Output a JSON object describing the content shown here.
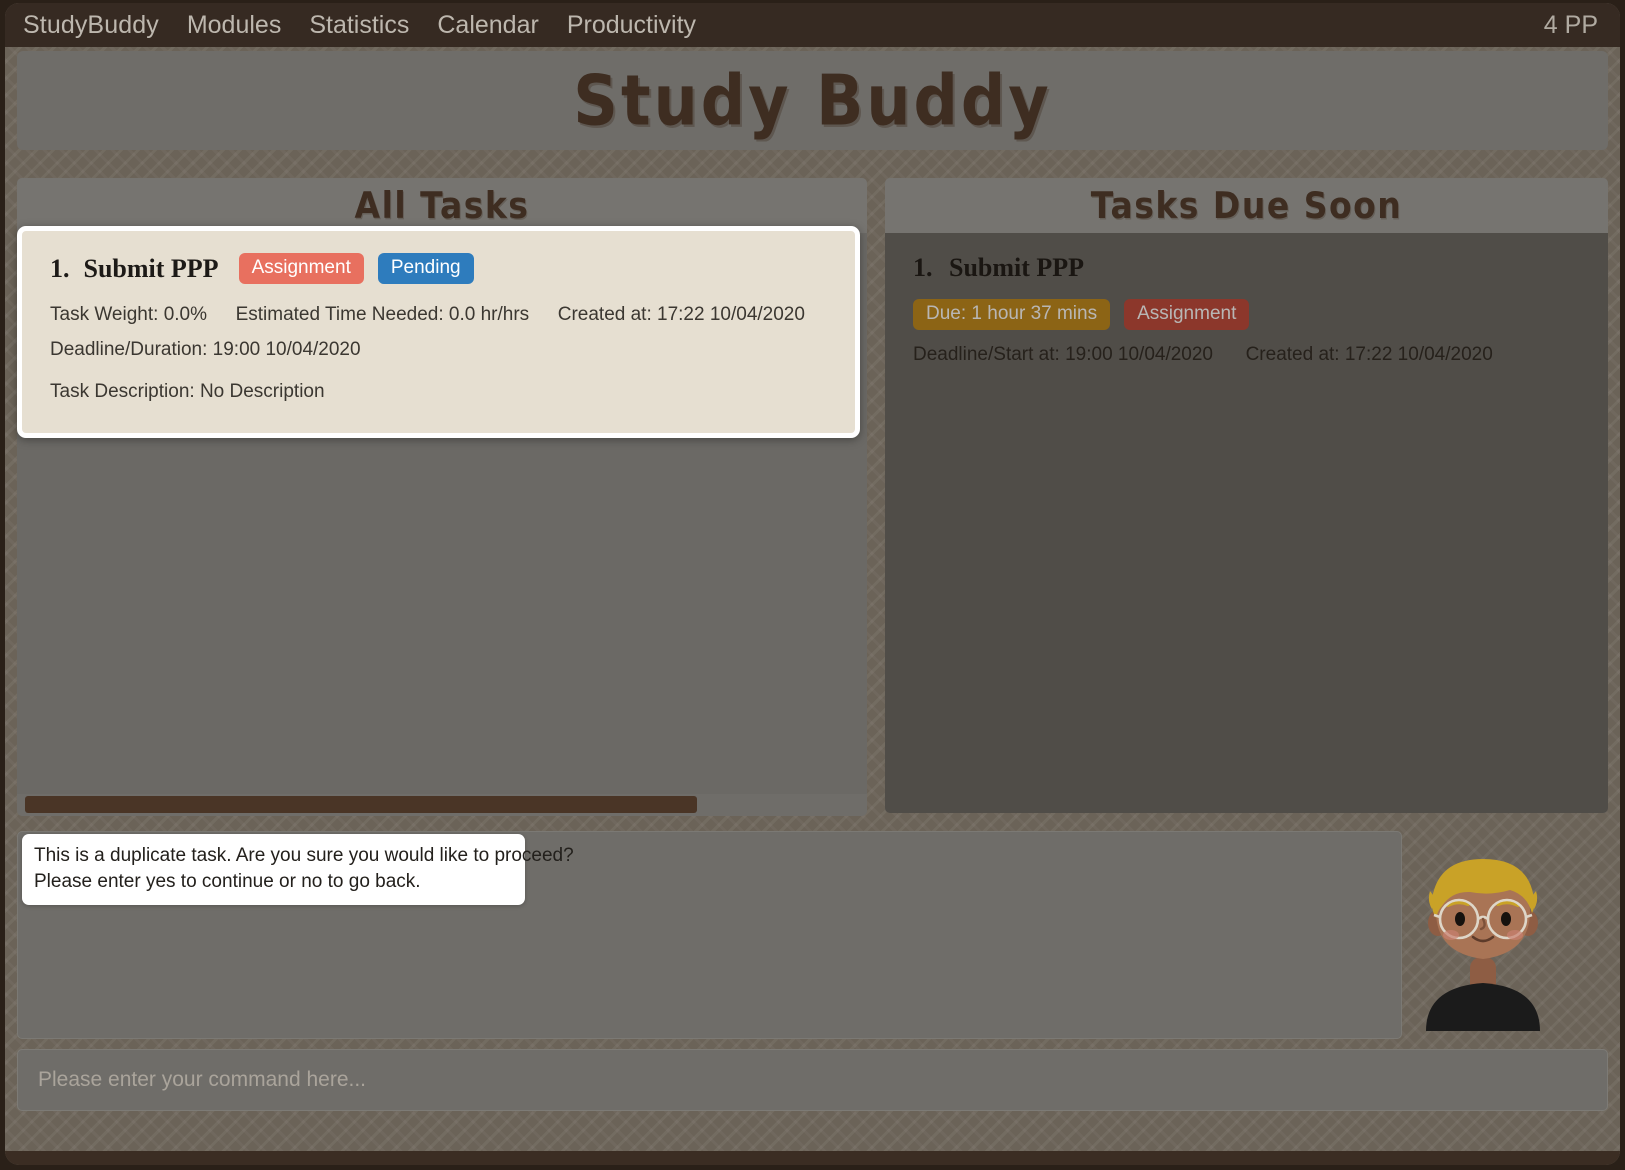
{
  "navbar": {
    "brand": "StudyBuddy",
    "links": [
      {
        "label": "Modules"
      },
      {
        "label": "Statistics"
      },
      {
        "label": "Calendar"
      },
      {
        "label": "Productivity"
      }
    ],
    "points": "4 PP"
  },
  "header": {
    "app_title": "Study Buddy"
  },
  "panels": {
    "all_tasks": {
      "heading": "All Tasks",
      "task": {
        "index": "1.",
        "name": "Submit PPP",
        "badges": [
          {
            "label": "Assignment",
            "color": "#e8705f"
          },
          {
            "label": "Pending",
            "color": "#2e7cbd"
          }
        ],
        "task_weight": "Task Weight: 0.0%",
        "estimated_time": "Estimated Time Needed: 0.0 hr/hrs",
        "created_at": "Created at: 17:22 10/04/2020",
        "deadline": "Deadline/Duration: 19:00 10/04/2020",
        "description": "Task Description: No Description"
      }
    },
    "tasks_due_soon": {
      "heading": "Tasks Due Soon",
      "task": {
        "index": "1.",
        "name": "Submit PPP",
        "badges": [
          {
            "label": "Due: 1 hour 37 mins",
            "color": "#c08a1c"
          },
          {
            "label": "Assignment",
            "color": "#c0493b"
          }
        ],
        "deadline": "Deadline/Start at: 19:00 10/04/2020",
        "created_at": "Created at: 17:22 10/04/2020"
      }
    }
  },
  "chat": {
    "bubble": {
      "line1": "This is a duplicate task. Are you sure you would like to proceed?",
      "line2": "Please enter yes to continue or no to go back."
    }
  },
  "command": {
    "value": "",
    "placeholder": "Please enter your command here..."
  },
  "avatar": {
    "name": "study-buddy-avatar",
    "hair_color": "#c9a227",
    "skin_color": "#a97455",
    "shirt_color": "#1b1b1b"
  }
}
